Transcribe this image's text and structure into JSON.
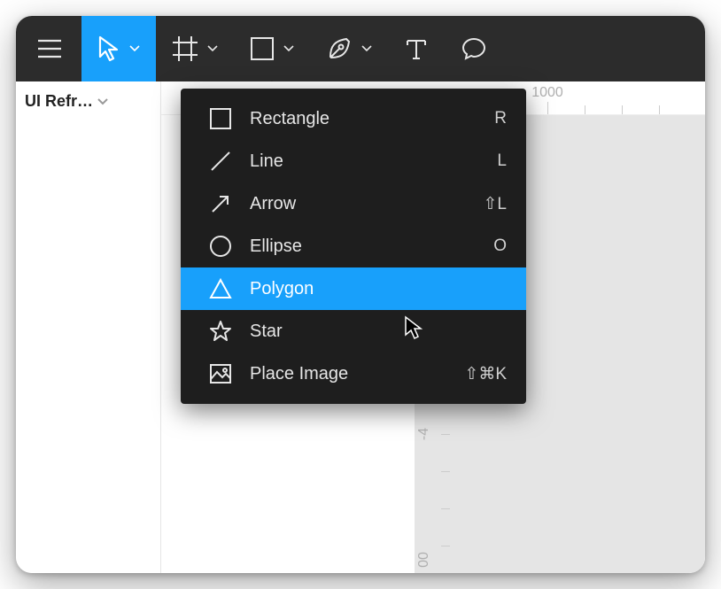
{
  "file": {
    "name": "UI Refr…"
  },
  "ruler": {
    "top_label": "1000",
    "left_label_1": "-4",
    "left_label_2": "00"
  },
  "shape_menu": {
    "items": [
      {
        "label": "Rectangle",
        "shortcut": "R"
      },
      {
        "label": "Line",
        "shortcut": "L"
      },
      {
        "label": "Arrow",
        "shortcut": "⇧L"
      },
      {
        "label": "Ellipse",
        "shortcut": "O"
      },
      {
        "label": "Polygon",
        "shortcut": ""
      },
      {
        "label": "Star",
        "shortcut": ""
      },
      {
        "label": "Place Image",
        "shortcut": "⇧⌘K"
      }
    ],
    "selected_index": 4
  }
}
